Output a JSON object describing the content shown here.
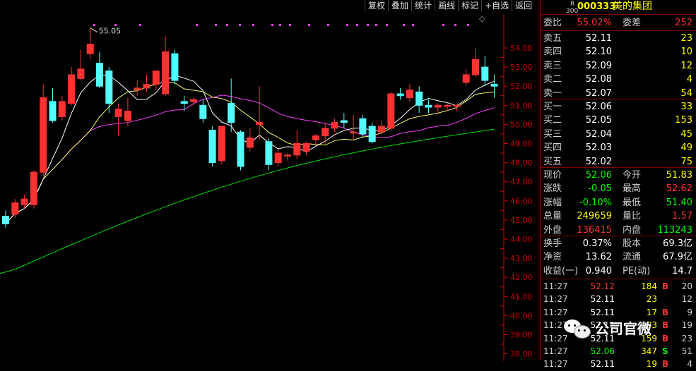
{
  "toolbar": {
    "items": [
      "复权",
      "叠加",
      "统计",
      "画线",
      "标记",
      "+自选",
      "返回"
    ]
  },
  "chart": {
    "type": "candlestick",
    "high_label": "55.05",
    "y_ticks": [
      "54.00",
      "53.00",
      "52.00",
      "51.00",
      "50.00",
      "49.00",
      "48.00",
      "47.00",
      "46.00",
      "45.00",
      "44.00",
      "43.00",
      "42.00",
      "41.00",
      "40.00",
      "39.00",
      "38.00"
    ],
    "colors": {
      "up": "#ff3232",
      "down": "#54ffff",
      "ma5": "#ffffff",
      "ma10": "#ffff66",
      "ma20": "#ff40ff",
      "ma60": "#00e000",
      "axis": "#cc0000"
    }
  },
  "quote": {
    "r_badge": "R",
    "r_num": "300",
    "code": "000333",
    "name": "美的集团",
    "wei_bi_label": "委比",
    "wei_bi": "55.02%",
    "wei_cha_label": "委差",
    "wei_cha": "252",
    "asks": [
      {
        "label": "卖五",
        "price": "52.11",
        "vol": "23"
      },
      {
        "label": "卖四",
        "price": "52.10",
        "vol": "10"
      },
      {
        "label": "卖三",
        "price": "52.09",
        "vol": "12"
      },
      {
        "label": "卖二",
        "price": "52.08",
        "vol": "4"
      },
      {
        "label": "卖一",
        "price": "52.07",
        "vol": "54"
      }
    ],
    "bids": [
      {
        "label": "买一",
        "price": "52.06",
        "vol": "33"
      },
      {
        "label": "买二",
        "price": "52.05",
        "vol": "153"
      },
      {
        "label": "买三",
        "price": "52.04",
        "vol": "45"
      },
      {
        "label": "买四",
        "price": "52.03",
        "vol": "49"
      },
      {
        "label": "买五",
        "price": "52.02",
        "vol": "75"
      }
    ],
    "stats": [
      {
        "l1": "现价",
        "v1": "52.06",
        "c1": "#00ff00",
        "l2": "今开",
        "v2": "51.83",
        "c2": "#ffff00"
      },
      {
        "l1": "涨跌",
        "v1": "-0.05",
        "c1": "#00ff00",
        "l2": "最高",
        "v2": "52.62",
        "c2": "#ff3232"
      },
      {
        "l1": "涨幅",
        "v1": "-0.10%",
        "c1": "#00ff00",
        "l2": "最低",
        "v2": "51.40",
        "c2": "#00ff00"
      },
      {
        "l1": "总量",
        "v1": "249659",
        "c1": "#ffff00",
        "l2": "量比",
        "v2": "1.57",
        "c2": "#ff3232"
      },
      {
        "l1": "外盘",
        "v1": "136415",
        "c1": "#ff3232",
        "l2": "内盘",
        "v2": "113243",
        "c2": "#00ff00"
      }
    ],
    "stats2": [
      {
        "l1": "换手",
        "v1": "0.37%",
        "l2": "股本",
        "v2": "69.3亿"
      },
      {
        "l1": "净资",
        "v1": "13.62",
        "l2": "流通",
        "v2": "67.9亿"
      },
      {
        "l1": "收益(一)",
        "v1": "0.940",
        "l2": "PE(动)",
        "v2": "14.7"
      }
    ],
    "ticks": [
      {
        "time": "11:27",
        "price": "52.12",
        "pc": "#ff3232",
        "vol": "184",
        "side": "B",
        "sc": "#ff3232",
        "n": "20"
      },
      {
        "time": "11:27",
        "price": "52.11",
        "pc": "#ffffff",
        "vol": "23",
        "side": "",
        "sc": "#ff3232",
        "n": "12"
      },
      {
        "time": "11:27",
        "price": "52.11",
        "pc": "#ffffff",
        "vol": "17",
        "side": "B",
        "sc": "#ff3232",
        "n": "9"
      },
      {
        "time": "11:27",
        "price": "52.11",
        "pc": "#ffffff",
        "vol": "183",
        "side": "B",
        "sc": "#ff3232",
        "n": "19"
      },
      {
        "time": "11:27",
        "price": "52.11",
        "pc": "#ffffff",
        "vol": "159",
        "side": "B",
        "sc": "#ff3232",
        "n": "23"
      },
      {
        "time": "11:27",
        "price": "52.06",
        "pc": "#00ff00",
        "vol": "347",
        "side": "S",
        "sc": "#00ff00",
        "n": "51"
      },
      {
        "time": "11:27",
        "price": "52.11",
        "pc": "#ffffff",
        "vol": "19",
        "side": "B",
        "sc": "#ff3232",
        "n": "4"
      }
    ]
  },
  "watermark": {
    "text": "公司官微"
  }
}
